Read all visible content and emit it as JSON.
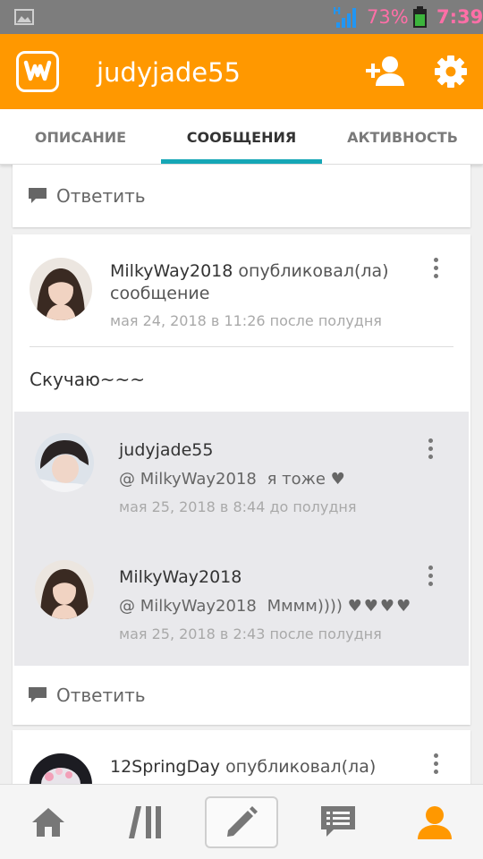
{
  "status_bar": {
    "network": "H",
    "battery_percent": "73%",
    "time": "7:39"
  },
  "header": {
    "title": "judyjade55",
    "logo_icon": "wattpad-logo",
    "add_user_icon": "add-user-icon",
    "settings_icon": "gear-icon",
    "accent_color": "#ff9800"
  },
  "tabs": [
    {
      "label": "ОПИСАНИЕ",
      "active": false
    },
    {
      "label": "СООБЩЕНИЯ",
      "active": true
    },
    {
      "label": "АКТИВНОСТЬ",
      "active": false
    }
  ],
  "reply_label": "Ответить",
  "post": {
    "author": "MilkyWay2018",
    "action": "опубликовал(ла)",
    "action_object": "сообщение",
    "timestamp": "мая 24, 2018 в 11:26 после полудня",
    "text": "Скучаю~~~"
  },
  "replies": [
    {
      "author": "judyjade55",
      "mention": "@ MilkyWay2018",
      "text": "я тоже",
      "hearts": "♥",
      "timestamp": "мая 25, 2018 в 8:44 до полудня"
    },
    {
      "author": "MilkyWay2018",
      "mention": "@ MilkyWay2018",
      "text": "Мммм))))",
      "hearts": "♥♥♥♥",
      "timestamp": "мая 25, 2018 в 2:43 после полудня"
    }
  ],
  "next_post": {
    "author": "12SpringDay",
    "action": "опубликовал(ла)"
  },
  "bottom_nav": [
    {
      "icon": "home-icon",
      "active": false
    },
    {
      "icon": "library-icon",
      "active": false
    },
    {
      "icon": "pencil-icon",
      "active": false
    },
    {
      "icon": "messages-icon",
      "active": false
    },
    {
      "icon": "profile-icon",
      "active": true
    }
  ]
}
